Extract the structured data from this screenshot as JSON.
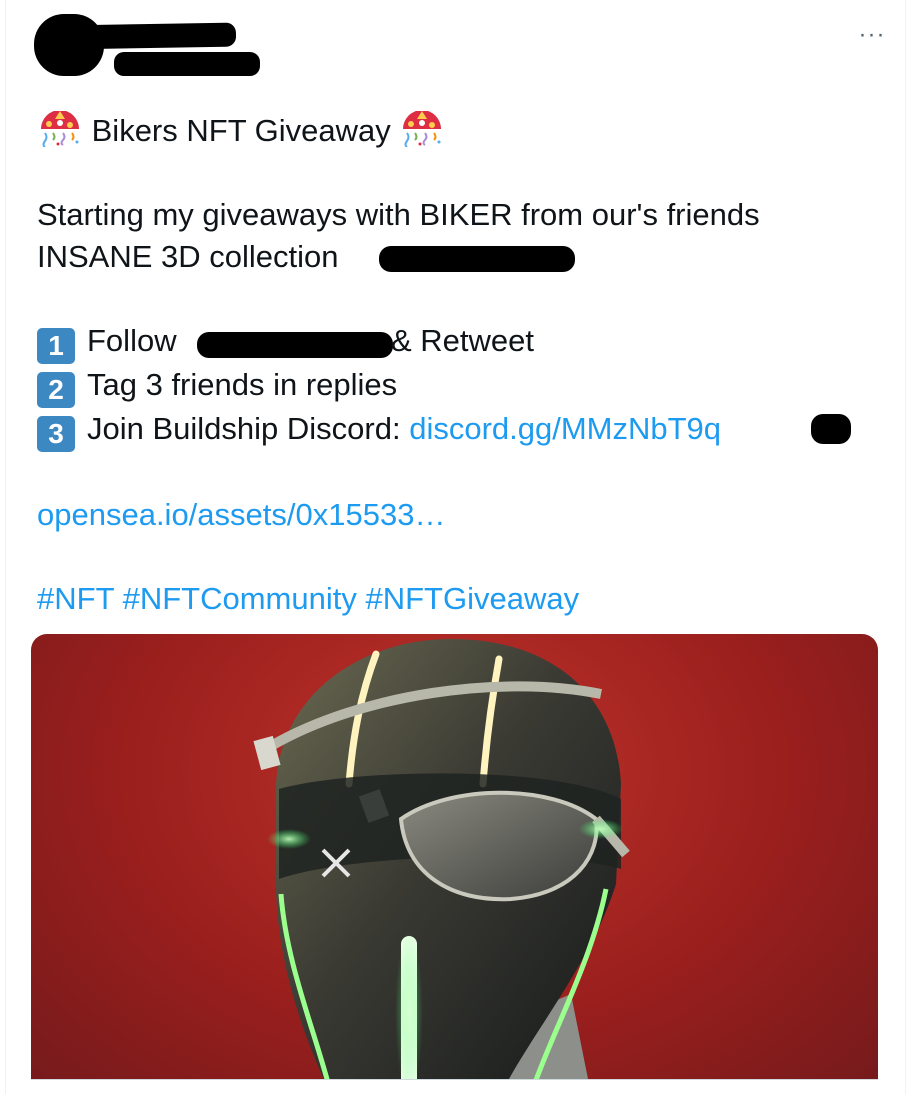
{
  "tweet": {
    "more_label": "···",
    "title": "Bikers NFT Giveaway",
    "intro_line1": "Starting my giveaways with BIKER from our's friends",
    "intro_line2": "INSANE 3D collection",
    "step1_label": "1",
    "step1_text": "Follow",
    "step1_suffix": "& Retweet",
    "step2_label": "2",
    "step2_text": "Tag 3 friends in replies",
    "step3_label": "3",
    "step3_text": "Join Buildship Discord: ",
    "discord_link": "discord.gg/MMzNbT9q",
    "opensea_link": "opensea.io/assets/0x15533…",
    "hashtags": [
      "#NFT",
      "#NFTCommunity",
      "#NFTGiveaway"
    ]
  },
  "colors": {
    "link": "#1d9bf0",
    "keycap": "#3b88c3",
    "media_background": "#9a1f1d"
  },
  "icons": {
    "title_emoji": "confetti-ball-icon",
    "more": "more-options-icon"
  }
}
